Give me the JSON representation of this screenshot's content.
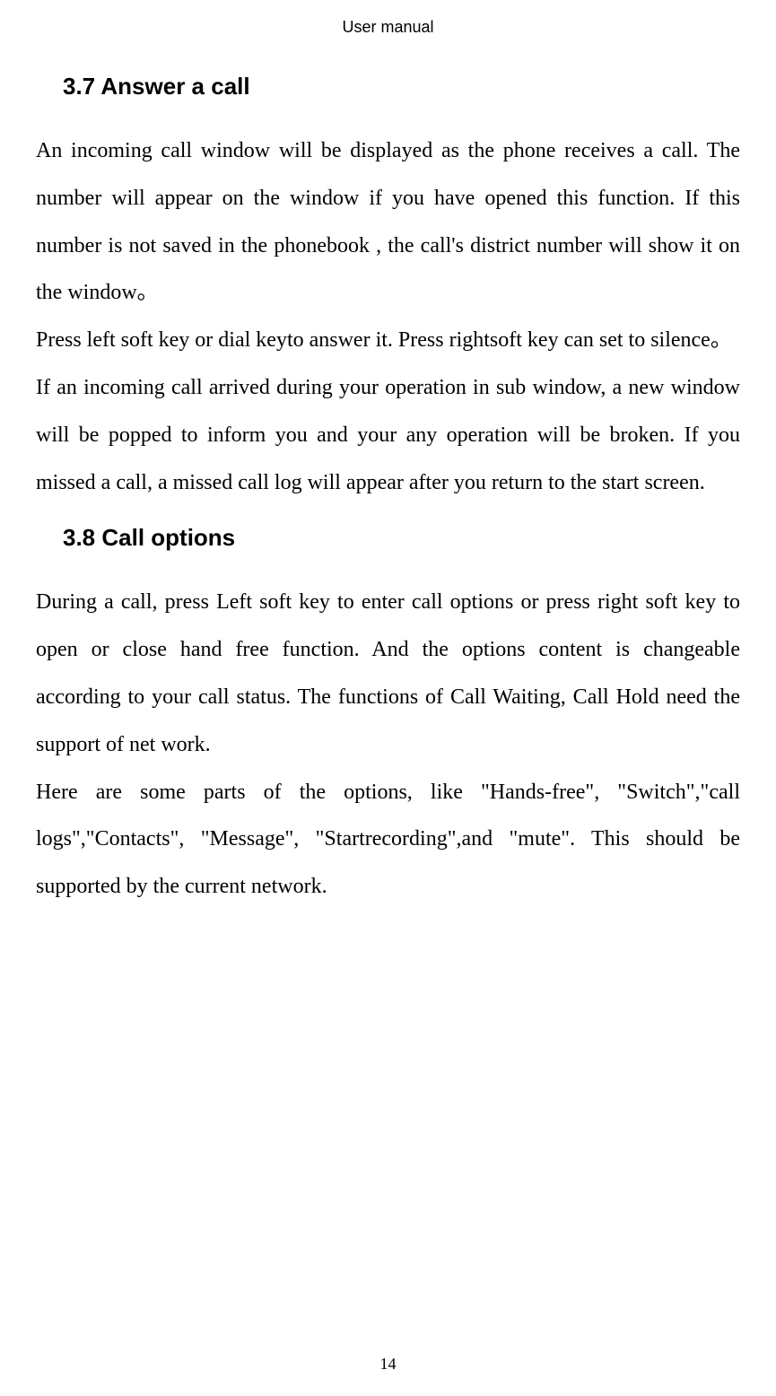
{
  "header": "User manual",
  "section1": {
    "heading": "3.7 Answer a call",
    "para1": "An incoming call window will be displayed as the phone receives a call. The number will appear on the window if you have opened this function. If this number is not saved in the phonebook , the call's district number will show it on the window。",
    "para2": "Press left soft key or dial keyto answer it. Press rightsoft key can set to silence。",
    "para3": "If an incoming call arrived during your operation in sub window, a new window will be popped to inform you and your any operation will be broken. If you missed a call, a missed call log will appear after you return to the start screen."
  },
  "section2": {
    "heading": "3.8 Call options",
    "para1": "During a call, press Left soft key to enter call options or press right soft key to open or close hand free function. And the options content is changeable according to your call status. The functions of Call Waiting, Call Hold need the support of net work.",
    "para2": "Here are some parts of the options, like \"Hands-free\", \"Switch\",\"call logs\",\"Contacts\", \"Message\", \"Startrecording\",and \"mute\". This should be supported by the current network."
  },
  "pageNumber": "14"
}
